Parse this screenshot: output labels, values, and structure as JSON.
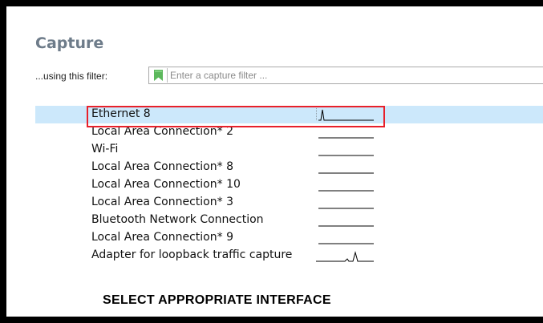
{
  "section": {
    "title": "Capture"
  },
  "filter": {
    "label": "...using this filter:",
    "placeholder": "Enter a capture filter ...",
    "value": ""
  },
  "interfaces": [
    {
      "name": "Ethernet 8",
      "selected": true,
      "activity": "spike-start"
    },
    {
      "name": "Local Area Connection* 2",
      "selected": false,
      "activity": "flat"
    },
    {
      "name": "Wi-Fi",
      "selected": false,
      "activity": "flat"
    },
    {
      "name": "Local Area Connection* 8",
      "selected": false,
      "activity": "flat"
    },
    {
      "name": "Local Area Connection* 10",
      "selected": false,
      "activity": "flat"
    },
    {
      "name": "Local Area Connection* 3",
      "selected": false,
      "activity": "flat"
    },
    {
      "name": "Bluetooth Network Connection",
      "selected": false,
      "activity": "flat"
    },
    {
      "name": "Local Area Connection* 9",
      "selected": false,
      "activity": "flat"
    },
    {
      "name": "Adapter for loopback traffic capture",
      "selected": false,
      "activity": "spike-end"
    }
  ],
  "caption": "SELECT APPROPRIATE INTERFACE",
  "colors": {
    "selection": "#cce8fb",
    "highlight": "#e8202a",
    "bookmark": "#5cb85c",
    "title": "#6e7c8a"
  },
  "icons": {
    "bookmark": "bookmark-icon"
  }
}
